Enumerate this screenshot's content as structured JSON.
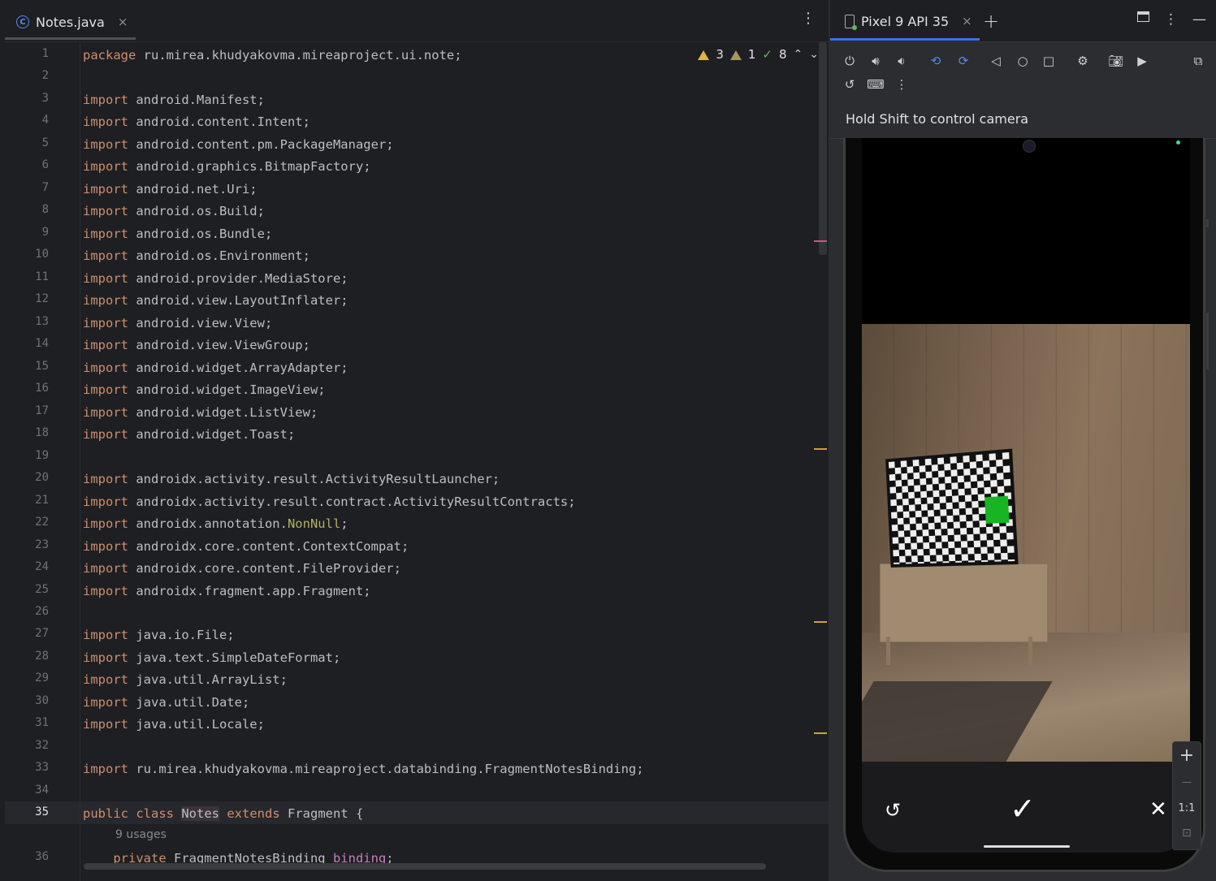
{
  "editor": {
    "tab_title": "Notes.java",
    "tab_icon": "C",
    "tab_close": "×",
    "menu": "⋮",
    "inspections": {
      "warnings": "3",
      "weak_warnings": "1",
      "typos": "8"
    },
    "current_line": "35",
    "usages_hint": "9 usages",
    "lines": [
      {
        "n": "1",
        "parts": [
          {
            "t": "package ",
            "c": "kw"
          },
          {
            "t": "ru.mirea.khudyakovma.mireaproject.ui.note;",
            "c": "pl"
          }
        ]
      },
      {
        "n": "2",
        "parts": []
      },
      {
        "n": "3",
        "parts": [
          {
            "t": "import ",
            "c": "kw"
          },
          {
            "t": "android.Manifest;",
            "c": "pl"
          }
        ]
      },
      {
        "n": "4",
        "parts": [
          {
            "t": "import ",
            "c": "kw"
          },
          {
            "t": "android.content.Intent;",
            "c": "pl"
          }
        ]
      },
      {
        "n": "5",
        "parts": [
          {
            "t": "import ",
            "c": "kw"
          },
          {
            "t": "android.content.pm.PackageManager;",
            "c": "pl"
          }
        ]
      },
      {
        "n": "6",
        "parts": [
          {
            "t": "import ",
            "c": "kw"
          },
          {
            "t": "android.graphics.BitmapFactory;",
            "c": "pl"
          }
        ]
      },
      {
        "n": "7",
        "parts": [
          {
            "t": "import ",
            "c": "kw"
          },
          {
            "t": "android.net.Uri;",
            "c": "pl"
          }
        ]
      },
      {
        "n": "8",
        "parts": [
          {
            "t": "import ",
            "c": "kw"
          },
          {
            "t": "android.os.Build;",
            "c": "pl"
          }
        ]
      },
      {
        "n": "9",
        "parts": [
          {
            "t": "import ",
            "c": "kw"
          },
          {
            "t": "android.os.Bundle;",
            "c": "pl"
          }
        ]
      },
      {
        "n": "10",
        "parts": [
          {
            "t": "import ",
            "c": "kw"
          },
          {
            "t": "android.os.Environment;",
            "c": "pl"
          }
        ]
      },
      {
        "n": "11",
        "parts": [
          {
            "t": "import ",
            "c": "kw"
          },
          {
            "t": "android.provider.MediaStore;",
            "c": "pl"
          }
        ]
      },
      {
        "n": "12",
        "parts": [
          {
            "t": "import ",
            "c": "kw"
          },
          {
            "t": "android.view.LayoutInflater;",
            "c": "pl"
          }
        ]
      },
      {
        "n": "13",
        "parts": [
          {
            "t": "import ",
            "c": "kw"
          },
          {
            "t": "android.view.View;",
            "c": "pl"
          }
        ]
      },
      {
        "n": "14",
        "parts": [
          {
            "t": "import ",
            "c": "kw"
          },
          {
            "t": "android.view.ViewGroup;",
            "c": "pl"
          }
        ]
      },
      {
        "n": "15",
        "parts": [
          {
            "t": "import ",
            "c": "kw"
          },
          {
            "t": "android.widget.ArrayAdapter;",
            "c": "pl"
          }
        ]
      },
      {
        "n": "16",
        "parts": [
          {
            "t": "import ",
            "c": "kw"
          },
          {
            "t": "android.widget.ImageView;",
            "c": "pl"
          }
        ]
      },
      {
        "n": "17",
        "parts": [
          {
            "t": "import ",
            "c": "kw"
          },
          {
            "t": "android.widget.ListView;",
            "c": "pl"
          }
        ]
      },
      {
        "n": "18",
        "parts": [
          {
            "t": "import ",
            "c": "kw"
          },
          {
            "t": "android.widget.Toast;",
            "c": "pl"
          }
        ]
      },
      {
        "n": "19",
        "parts": []
      },
      {
        "n": "20",
        "parts": [
          {
            "t": "import ",
            "c": "kw"
          },
          {
            "t": "androidx.activity.result.ActivityResultLauncher;",
            "c": "pl"
          }
        ]
      },
      {
        "n": "21",
        "parts": [
          {
            "t": "import ",
            "c": "kw"
          },
          {
            "t": "androidx.activity.result.contract.ActivityResultContracts;",
            "c": "pl"
          }
        ]
      },
      {
        "n": "22",
        "parts": [
          {
            "t": "import ",
            "c": "kw"
          },
          {
            "t": "androidx.annotation.",
            "c": "pl"
          },
          {
            "t": "NonNull",
            "c": "ann"
          },
          {
            "t": ";",
            "c": "pl"
          }
        ]
      },
      {
        "n": "23",
        "parts": [
          {
            "t": "import ",
            "c": "kw"
          },
          {
            "t": "androidx.core.content.ContextCompat;",
            "c": "pl"
          }
        ]
      },
      {
        "n": "24",
        "parts": [
          {
            "t": "import ",
            "c": "kw"
          },
          {
            "t": "androidx.core.content.FileProvider;",
            "c": "pl"
          }
        ]
      },
      {
        "n": "25",
        "parts": [
          {
            "t": "import ",
            "c": "kw"
          },
          {
            "t": "androidx.fragment.app.Fragment;",
            "c": "pl"
          }
        ]
      },
      {
        "n": "26",
        "parts": []
      },
      {
        "n": "27",
        "parts": [
          {
            "t": "import ",
            "c": "kw"
          },
          {
            "t": "java.io.File;",
            "c": "pl"
          }
        ]
      },
      {
        "n": "28",
        "parts": [
          {
            "t": "import ",
            "c": "kw"
          },
          {
            "t": "java.text.SimpleDateFormat;",
            "c": "pl"
          }
        ]
      },
      {
        "n": "29",
        "parts": [
          {
            "t": "import ",
            "c": "kw"
          },
          {
            "t": "java.util.ArrayList;",
            "c": "pl"
          }
        ]
      },
      {
        "n": "30",
        "parts": [
          {
            "t": "import ",
            "c": "kw"
          },
          {
            "t": "java.util.Date;",
            "c": "pl"
          }
        ]
      },
      {
        "n": "31",
        "parts": [
          {
            "t": "import ",
            "c": "kw"
          },
          {
            "t": "java.util.Locale;",
            "c": "pl"
          }
        ]
      },
      {
        "n": "32",
        "parts": []
      },
      {
        "n": "33",
        "parts": [
          {
            "t": "import ",
            "c": "kw"
          },
          {
            "t": "ru.mirea.khudyakovma.mireaproject.databinding.FragmentNotesBinding;",
            "c": "pl"
          }
        ]
      },
      {
        "n": "34",
        "parts": []
      },
      {
        "n": "35",
        "parts": [
          {
            "t": "public class ",
            "c": "kw"
          },
          {
            "t": "Notes",
            "c": "pl hl-name"
          },
          {
            "t": " extends ",
            "c": "kw"
          },
          {
            "t": "Fragment {",
            "c": "pl"
          }
        ]
      },
      {
        "n": "36",
        "parts": [
          {
            "t": "    private ",
            "c": "kw"
          },
          {
            "t": "FragmentNotesBinding ",
            "c": "pl"
          },
          {
            "t": "binding",
            "c": "fld"
          },
          {
            "t": ";",
            "c": "pl"
          }
        ]
      }
    ]
  },
  "device": {
    "tab_title": "Pixel 9 API 35",
    "tab_close": "×",
    "add_tab": "+",
    "hint": "Hold Shift to control camera",
    "zoom_in": "+",
    "zoom_out": "—",
    "zoom_actual": "1:1",
    "camera_controls": {
      "retake": "↺",
      "accept": "✓",
      "cancel": "✕"
    }
  },
  "colors": {
    "keyword": "#cf8e6d",
    "plain": "#bcbec4",
    "annotation": "#b3ae60",
    "field": "#c77dbb",
    "accent": "#3574f0"
  }
}
